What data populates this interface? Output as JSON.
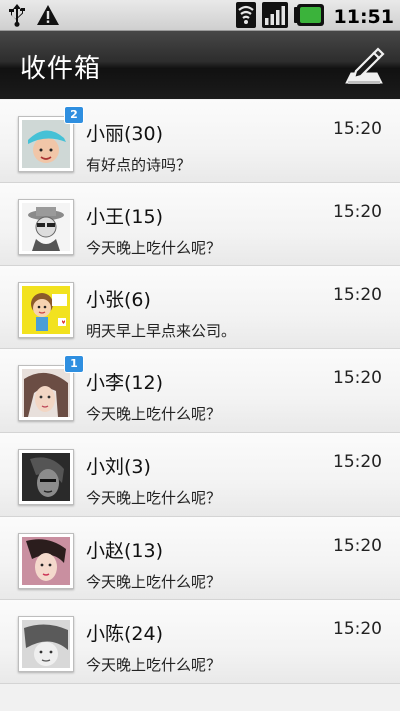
{
  "status": {
    "time": "11:51",
    "icons": [
      "usb-icon",
      "warning-icon",
      "wifi-icon",
      "signal-icon",
      "battery-icon"
    ],
    "battery_color": "#3bb33b"
  },
  "header": {
    "title": "收件箱",
    "compose_icon": "compose-icon"
  },
  "messages": [
    {
      "name": "小丽(30)",
      "time": "15:20",
      "preview": "有好点的诗吗？",
      "badge": "2",
      "avatar_color": "#45c1d6"
    },
    {
      "name": "小王(15)",
      "time": "15:20",
      "preview": "今天晚上吃什么呢？",
      "badge": "",
      "avatar_color": "#9a9a9a"
    },
    {
      "name": "小张(6)",
      "time": "15:20",
      "preview": "明天早上早点来公司。",
      "badge": "",
      "avatar_color": "#f2e21f"
    },
    {
      "name": "小李(12)",
      "time": "15:20",
      "preview": "今天晚上吃什么呢？",
      "badge": "1",
      "avatar_color": "#6b4d44"
    },
    {
      "name": "小刘(3)",
      "time": "15:20",
      "preview": "今天晚上吃什么呢？",
      "badge": "",
      "avatar_color": "#2a2a2a"
    },
    {
      "name": "小赵(13)",
      "time": "15:20",
      "preview": "今天晚上吃什么呢？",
      "badge": "",
      "avatar_color": "#c98fa0"
    },
    {
      "name": "小陈(24)",
      "time": "15:20",
      "preview": "今天晚上吃什么呢？",
      "badge": "",
      "avatar_color": "#5a5a5a"
    }
  ]
}
